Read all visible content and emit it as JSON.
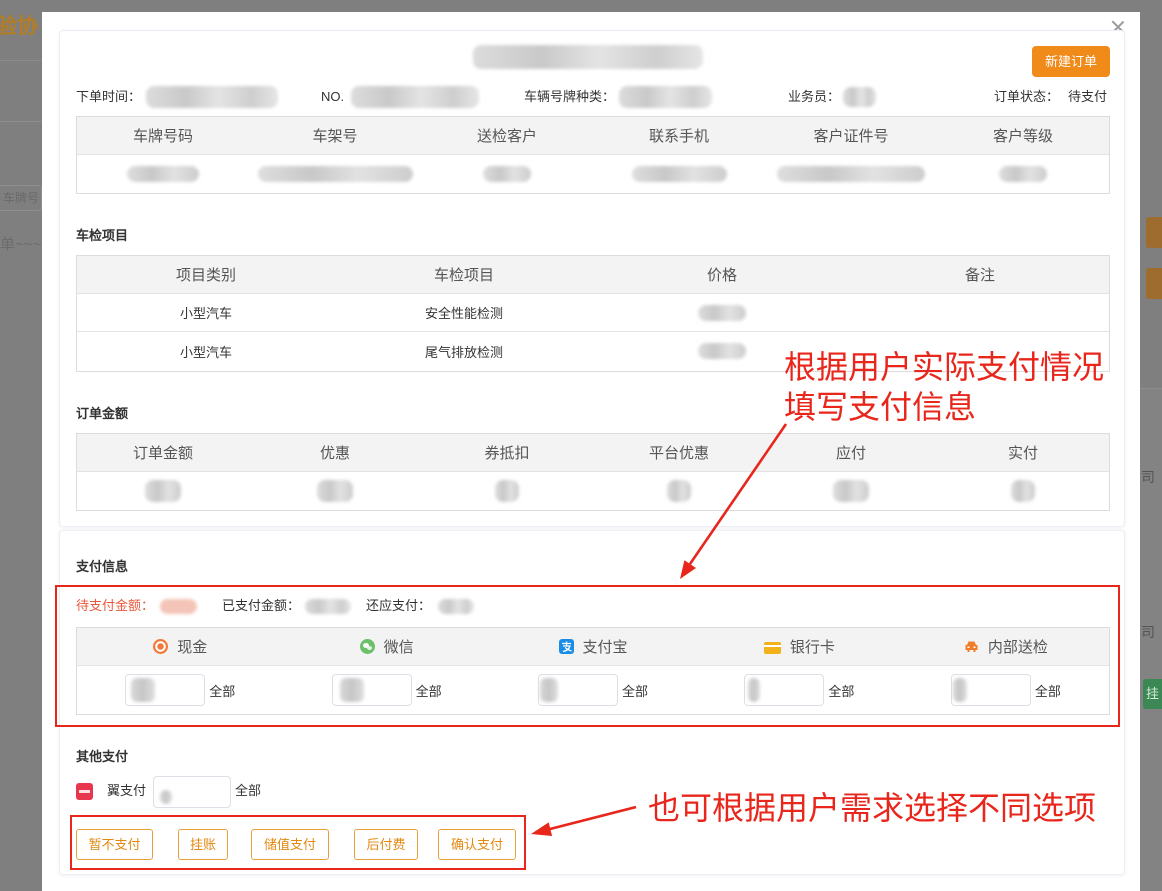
{
  "background_page": {
    "brand_fragment": "验协",
    "plate_input_fragment": "车牌号",
    "empty_text_fragment": "单~~~",
    "side_fragment_1": "司",
    "side_fragment_2": "司",
    "hang_button_fragment": "挂"
  },
  "dialog": {
    "new_order_label": "新建订单",
    "info": {
      "order_time_label": "下单时间：",
      "order_no_label": "NO.",
      "plate_type_label": "车辆号牌种类：",
      "salesperson_label": "业务员：",
      "status_label": "订单状态：",
      "status_value": "待支付"
    },
    "vehicle_table": {
      "headers": [
        "车牌号码",
        "车架号",
        "送检客户",
        "联系手机",
        "客户证件号",
        "客户等级"
      ]
    },
    "inspection": {
      "title": "车检项目",
      "headers": [
        "项目类别",
        "车检项目",
        "价格",
        "备注"
      ],
      "rows": [
        {
          "category": "小型汽车",
          "item": "安全性能检测"
        },
        {
          "category": "小型汽车",
          "item": "尾气排放检测"
        }
      ]
    },
    "amount": {
      "title": "订单金额",
      "headers": [
        "订单金额",
        "优惠",
        "券抵扣",
        "平台优惠",
        "应付",
        "实付"
      ]
    },
    "payment": {
      "title": "支付信息",
      "pending_label": "待支付金额：",
      "paid_label": "已支付金额：",
      "remaining_label": "还应支付：",
      "methods": [
        {
          "label": "现金",
          "icon": "cash-icon",
          "all_label": "全部"
        },
        {
          "label": "微信",
          "icon": "wechat-icon",
          "all_label": "全部"
        },
        {
          "label": "支付宝",
          "icon": "alipay-icon",
          "all_label": "全部"
        },
        {
          "label": "银行卡",
          "icon": "bank-card-icon",
          "all_label": "全部"
        },
        {
          "label": "内部送检",
          "icon": "car-icon",
          "all_label": "全部"
        }
      ]
    },
    "other_payment": {
      "title": "其他支付",
      "method_label": "翼支付",
      "icon": "yipay-icon",
      "all_label": "全部"
    },
    "actions": [
      "暂不支付",
      "挂账",
      "储值支付",
      "后付费",
      "确认支付"
    ]
  },
  "annotations": {
    "payment_hint_line1": "根据用户实际支付情况",
    "payment_hint_line2": "填写支付信息",
    "actions_hint": "也可根据用户需求选择不同选项"
  },
  "colors": {
    "accent_orange": "#f08a19",
    "annotation_red": "#e8261c",
    "pending_amount_red": "#e9573a",
    "overlay_grey": "#7f7f7f"
  }
}
